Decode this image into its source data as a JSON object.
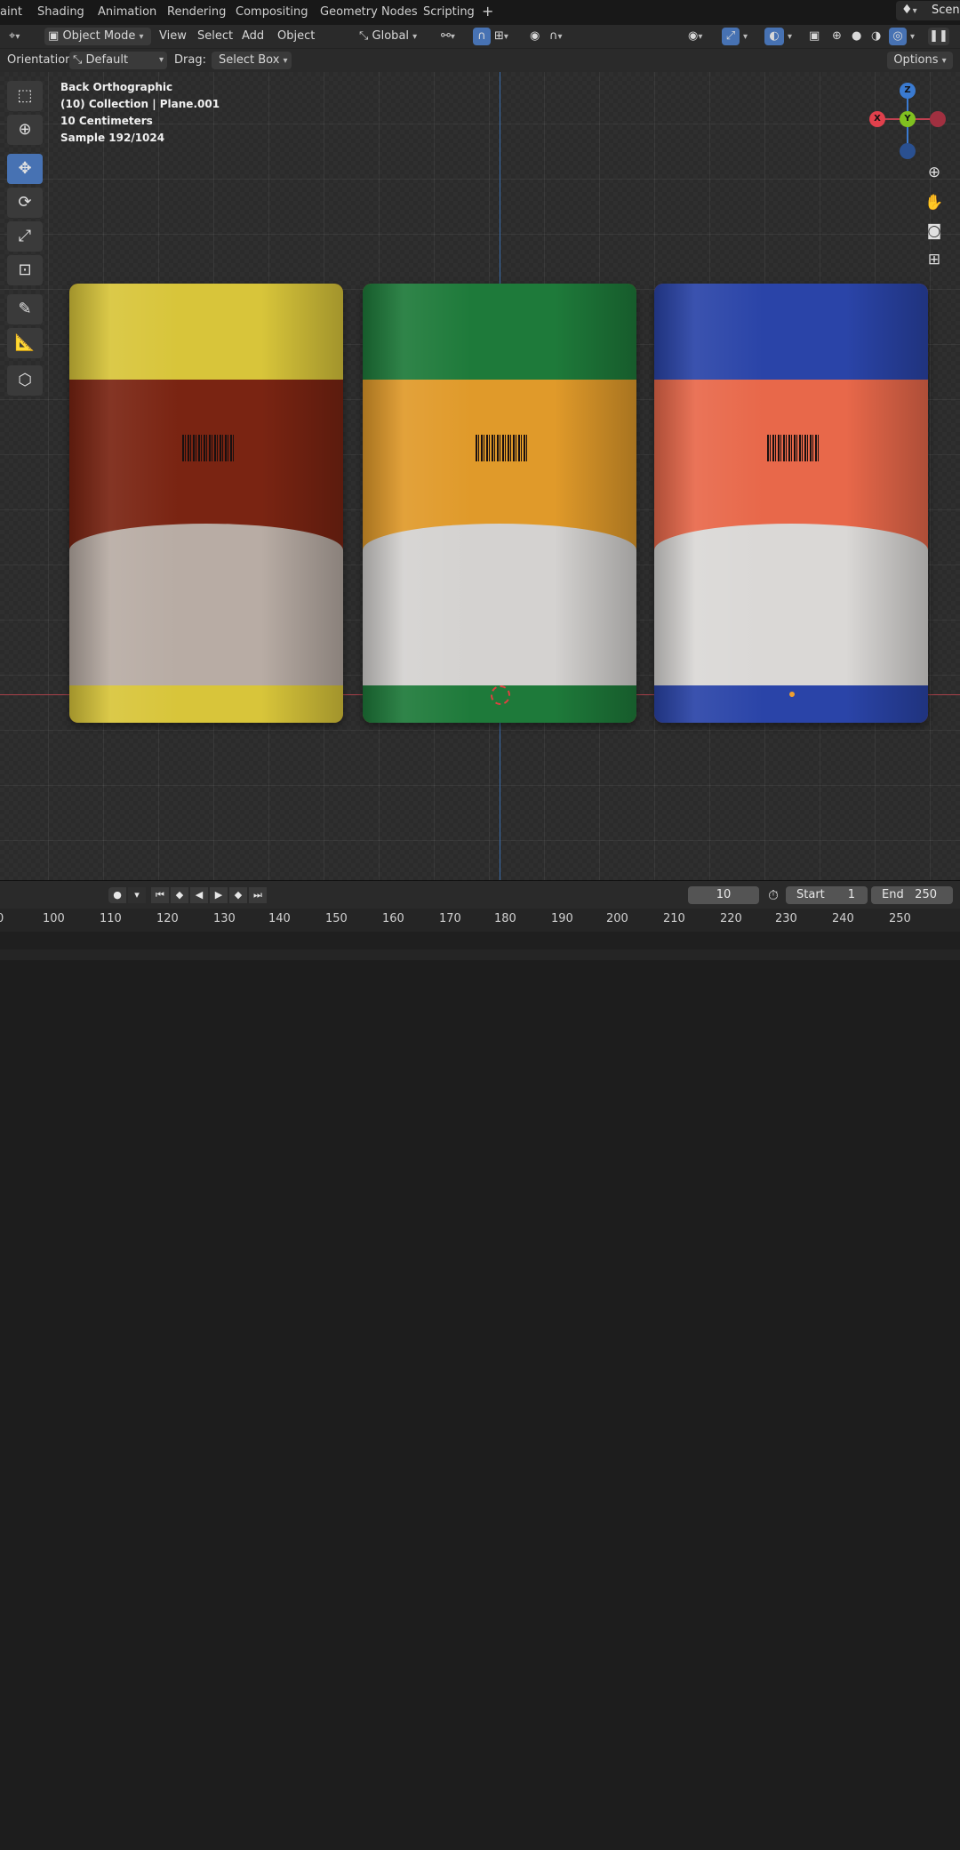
{
  "workspace_tabs": [
    "aint",
    "Shading",
    "Animation",
    "Rendering",
    "Compositing",
    "Geometry Nodes",
    "Scripting",
    "+"
  ],
  "scene": {
    "name": "Scene",
    "icon": "scene-icon"
  },
  "header": {
    "mode": "Object Mode",
    "menus": [
      "View",
      "Select",
      "Add",
      "Object"
    ],
    "transform_orientation": "Global"
  },
  "tool_settings": {
    "orientation_label": "Orientation:",
    "orientation_value": "Default",
    "drag_label": "Drag:",
    "drag_value": "Select Box",
    "options_label": "Options"
  },
  "viewport_info": {
    "view": "Back Orthographic",
    "collection": "(10) Collection | Plane.001",
    "scale": "10 Centimeters",
    "sample": "Sample 192/1024"
  },
  "gizmo": {
    "x": "X",
    "y": "Y",
    "z": "Z",
    "colors": {
      "x": "#e0404c",
      "y": "#80c020",
      "z": "#3a7ad0"
    }
  },
  "packages": [
    {
      "top": "#d8c53a",
      "mid": "#7a2412",
      "bottom": "#d8c53a",
      "window": "#b8aca4"
    },
    {
      "top": "#1e7a3a",
      "mid": "#e09a2a",
      "bottom": "#1e7a3a",
      "window": "#d4d2d0"
    },
    {
      "top": "#2a44a8",
      "mid": "#e8684a",
      "bottom": "#2a44a8",
      "window": "#dad8d6"
    }
  ],
  "timeline": {
    "current_frame": "10",
    "start_label": "Start",
    "start_value": "1",
    "end_label": "End",
    "end_value": "250",
    "ticks": [
      "0",
      "100",
      "110",
      "120",
      "130",
      "140",
      "150",
      "160",
      "170",
      "180",
      "190",
      "200",
      "210",
      "220",
      "230",
      "240",
      "250"
    ]
  },
  "colors": {
    "accent": "#4772b3",
    "axis_x": "#a8414a",
    "axis_z": "#3a6fb0"
  }
}
